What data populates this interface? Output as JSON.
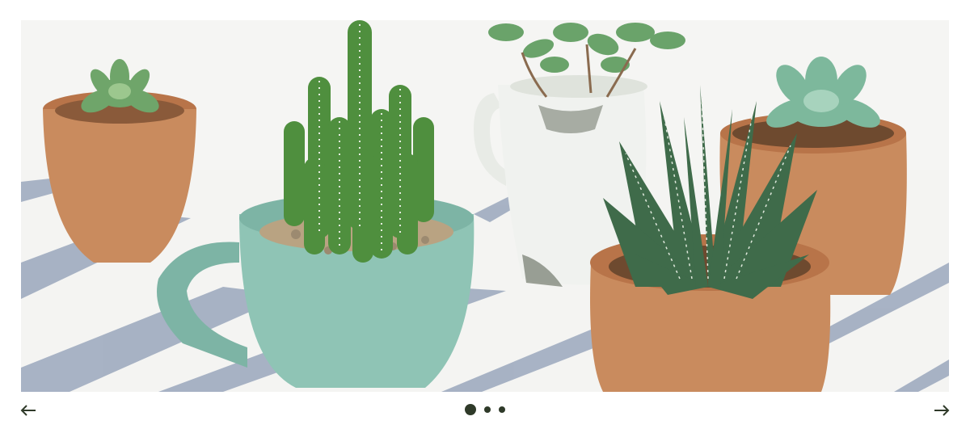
{
  "carousel": {
    "slide_count": 3,
    "active_index": 0,
    "slide_image": "potted-succulents-photo",
    "prev_icon": "arrow-left-icon",
    "next_icon": "arrow-right-icon"
  },
  "colors": {
    "control": "#2f3a29",
    "terracotta": "#c98b5e",
    "celadon": "#8fc4b5",
    "cactus_green": "#4f8f3e",
    "stripe_blue": "#9aa7bd"
  }
}
